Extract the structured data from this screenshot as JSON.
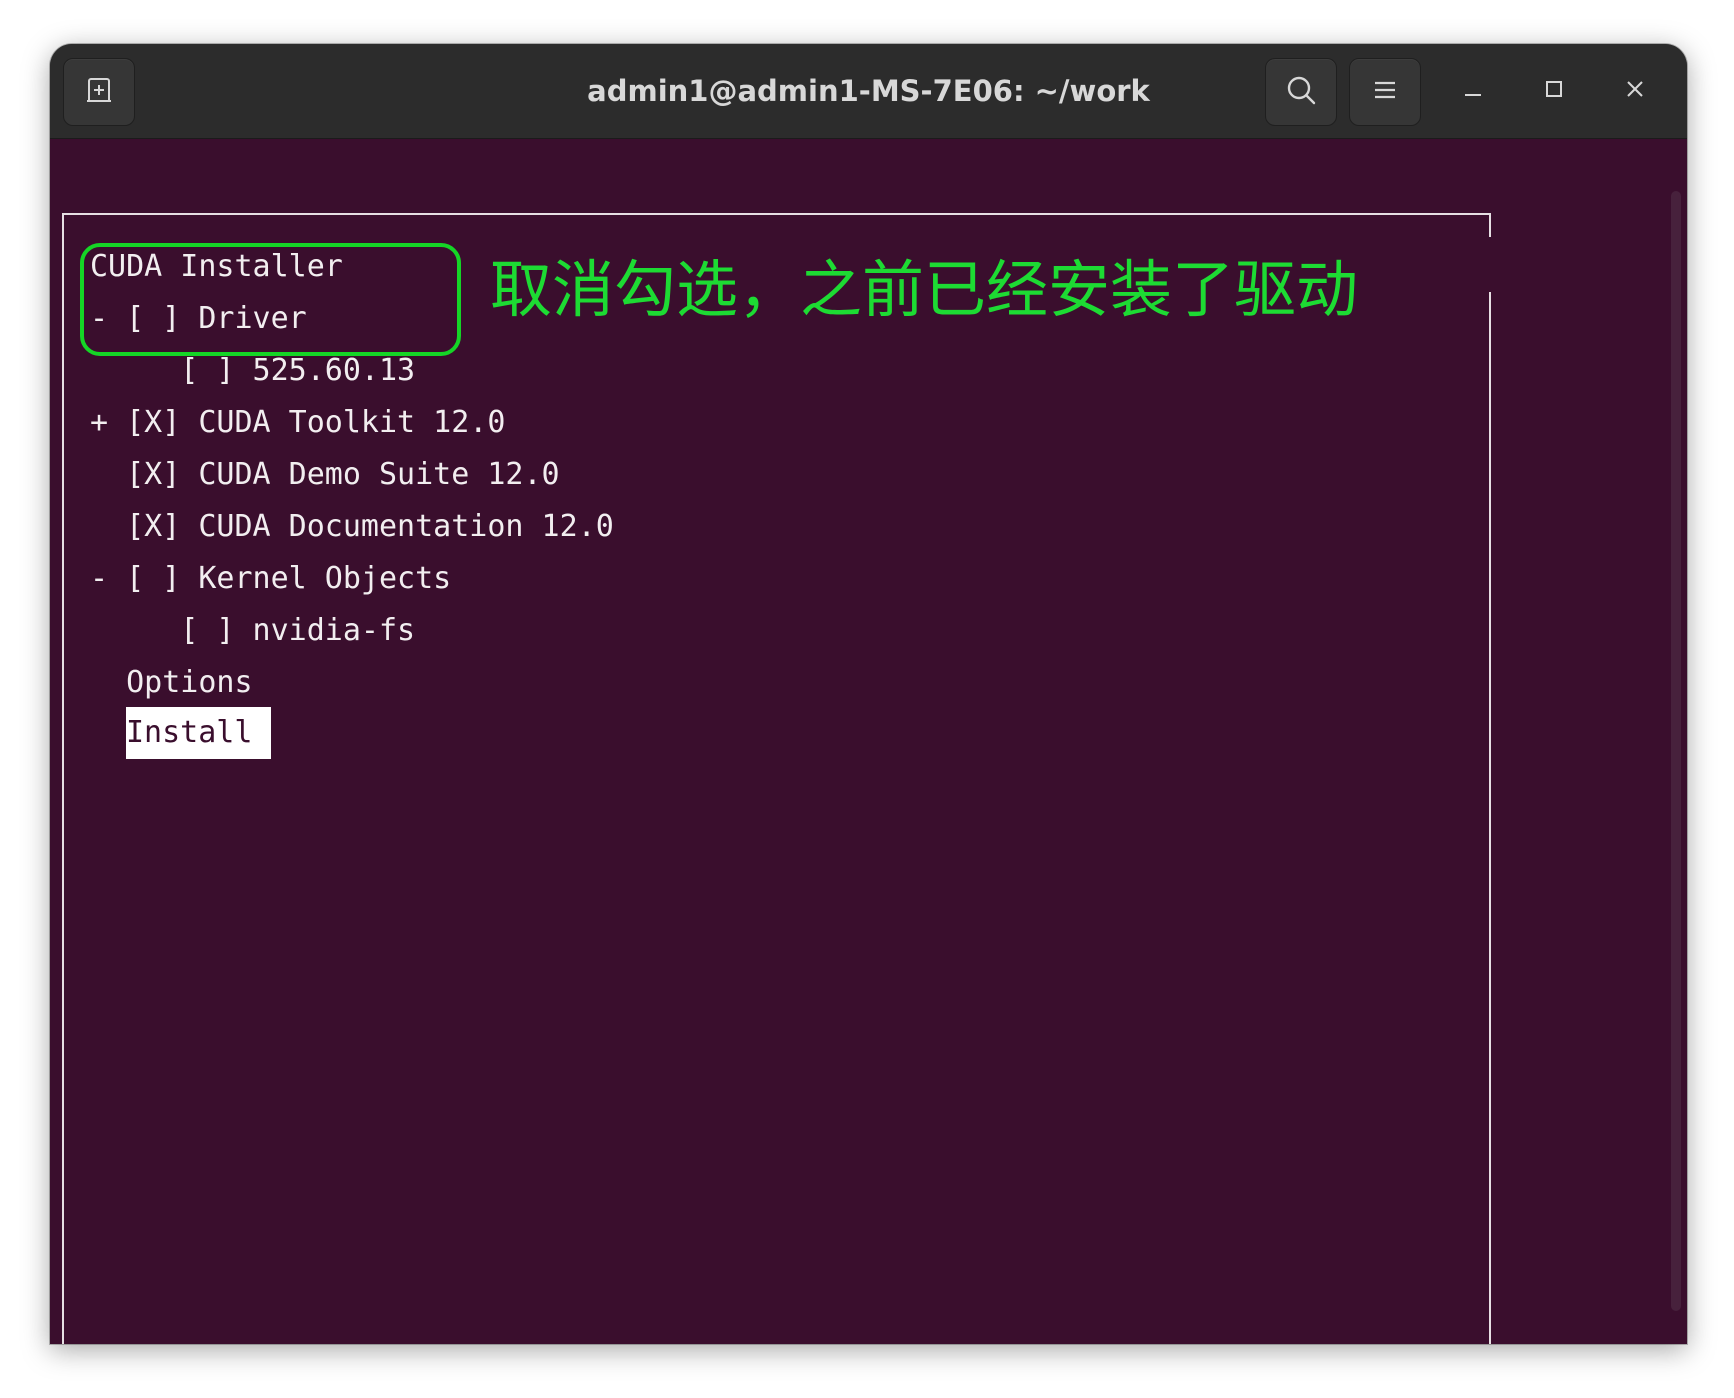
{
  "window": {
    "title": "admin1@admin1-MS-7E06: ~/work"
  },
  "titlebar": {
    "icons": {
      "new_tab": "new-tab-icon",
      "search": "search-icon",
      "menu": "hamburger-menu-icon",
      "minimize": "minimize-icon",
      "maximize": "maximize-icon",
      "close": "close-icon"
    }
  },
  "installer": {
    "heading": "CUDA Installer",
    "lines": [
      "- [ ] Driver",
      "     [ ] 525.60.13",
      "+ [X] CUDA Toolkit 12.0",
      "  [X] CUDA Demo Suite 12.0",
      "  [X] CUDA Documentation 12.0",
      "- [ ] Kernel Objects",
      "     [ ] nvidia-fs",
      "  Options"
    ],
    "install_label": "Install"
  },
  "annotation": {
    "text": "取消勾选，之前已经安装了驱动",
    "color": "#1ddb33"
  },
  "colors": {
    "terminal_bg": "#3a0e2d",
    "titlebar_bg": "#2c2c2c",
    "terminal_fg": "#f2eef0",
    "annotation_green": "#15d526"
  }
}
